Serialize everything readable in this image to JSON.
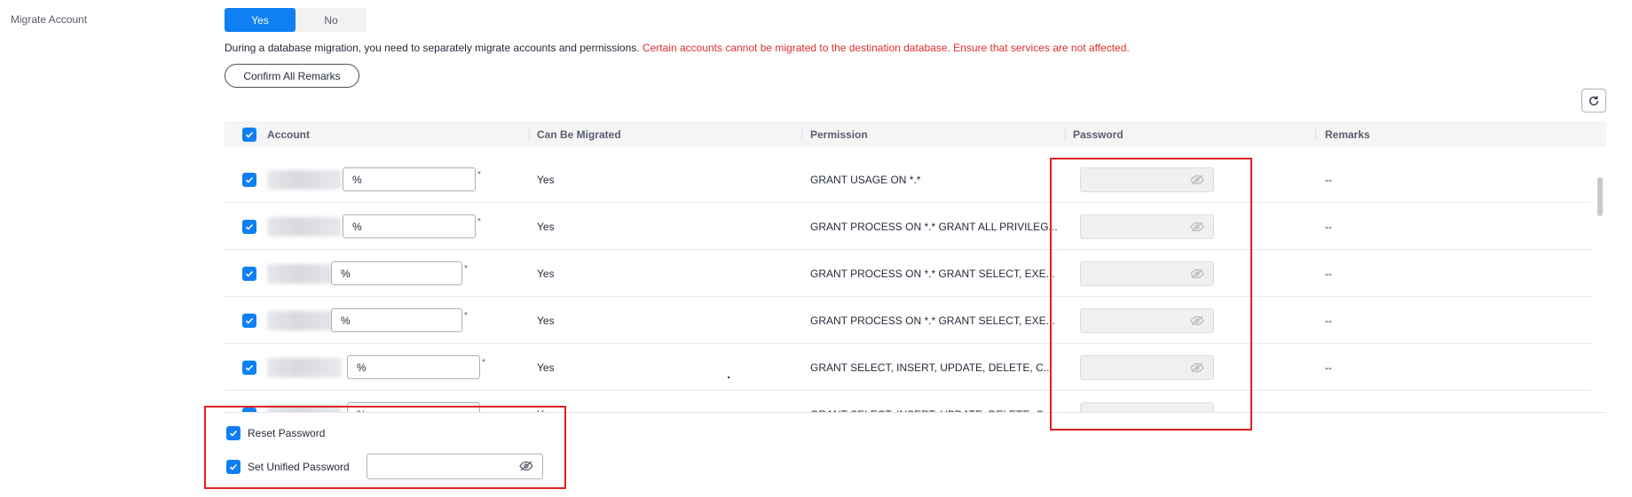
{
  "migrate_account": {
    "label": "Migrate Account",
    "options": [
      "Yes",
      "No"
    ],
    "selected": "Yes"
  },
  "notice": {
    "text": "During a database migration, you need to separately migrate accounts and permissions.",
    "warning": "Certain accounts cannot be migrated to the destination database. Ensure that services are not affected."
  },
  "confirm_button_label": "Confirm All Remarks",
  "table": {
    "columns": [
      "Account",
      "Can Be Migrated",
      "Permission",
      "Password",
      "Remarks"
    ],
    "rows": [
      {
        "host": "%",
        "can_migrate": "Yes",
        "permission": "GRANT USAGE ON *.*",
        "remarks": "--",
        "checked": true
      },
      {
        "host": "%",
        "can_migrate": "Yes",
        "permission": "GRANT PROCESS ON *.* GRANT ALL PRIVILEG...",
        "remarks": "--",
        "checked": true
      },
      {
        "host": "%",
        "can_migrate": "Yes",
        "permission": "GRANT PROCESS ON *.* GRANT SELECT, EXE...",
        "remarks": "--",
        "checked": true
      },
      {
        "host": "%",
        "can_migrate": "Yes",
        "permission": "GRANT PROCESS ON *.* GRANT SELECT, EXE...",
        "remarks": "--",
        "checked": true
      },
      {
        "host": "%",
        "can_migrate": "Yes",
        "permission": "GRANT SELECT, INSERT, UPDATE, DELETE, C...",
        "remarks": "--",
        "checked": true
      },
      {
        "host": "%",
        "can_migrate": "Y",
        "permission": "GRANT SELECT, INSERT, UPDATE, DELETE, C...",
        "remarks": "--",
        "checked": true
      }
    ]
  },
  "reset_password_label": "Reset Password",
  "set_unified_password_label": "Set Unified Password",
  "colors": {
    "accent": "#0f7ff4",
    "warning": "#e02e2e",
    "highlight_box": "#e02020"
  },
  "icons": [
    "refresh-icon",
    "eye-hidden-icon",
    "checkmark-icon"
  ]
}
